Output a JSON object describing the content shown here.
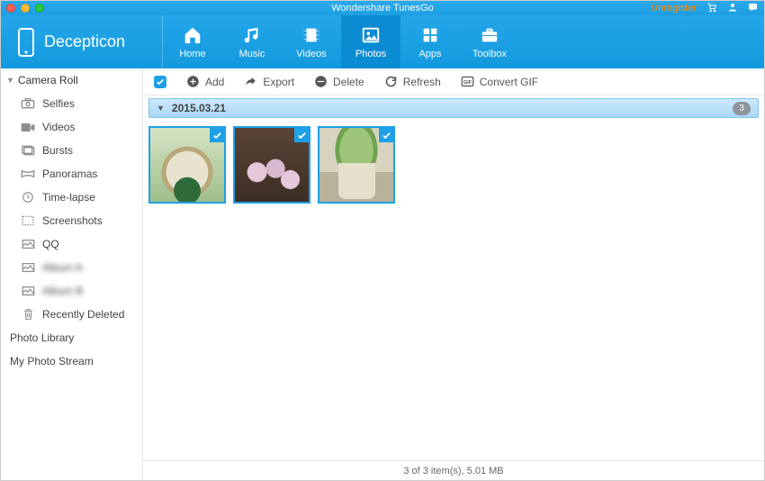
{
  "app_title": "Wondershare TunesGo",
  "header": {
    "unregister": "Unregister",
    "device_name": "Decepticon",
    "nav": [
      {
        "label": "Home"
      },
      {
        "label": "Music"
      },
      {
        "label": "Videos"
      },
      {
        "label": "Photos"
      },
      {
        "label": "Apps"
      },
      {
        "label": "Toolbox"
      }
    ]
  },
  "sidebar": {
    "root": "Camera Roll",
    "items": [
      {
        "label": "Selfies",
        "icon": "camera"
      },
      {
        "label": "Videos",
        "icon": "video"
      },
      {
        "label": "Bursts",
        "icon": "burst"
      },
      {
        "label": "Panoramas",
        "icon": "pano"
      },
      {
        "label": "Time-lapse",
        "icon": "clock"
      },
      {
        "label": "Screenshots",
        "icon": "dashed"
      },
      {
        "label": "QQ",
        "icon": "image"
      },
      {
        "label": "Album A",
        "icon": "image",
        "blur": true
      },
      {
        "label": "Album B",
        "icon": "image",
        "blur": true
      },
      {
        "label": "Recently Deleted",
        "icon": "trash"
      }
    ],
    "extra": [
      {
        "label": "Photo Library",
        "selected": true
      },
      {
        "label": "My Photo Stream"
      }
    ]
  },
  "toolbar": {
    "add": "Add",
    "export": "Export",
    "delete": "Delete",
    "refresh": "Refresh",
    "convertgif": "Convert GIF"
  },
  "group": {
    "date": "2015.03.21",
    "count": "3"
  },
  "status": "3 of 3 item(s), 5.01 MB"
}
